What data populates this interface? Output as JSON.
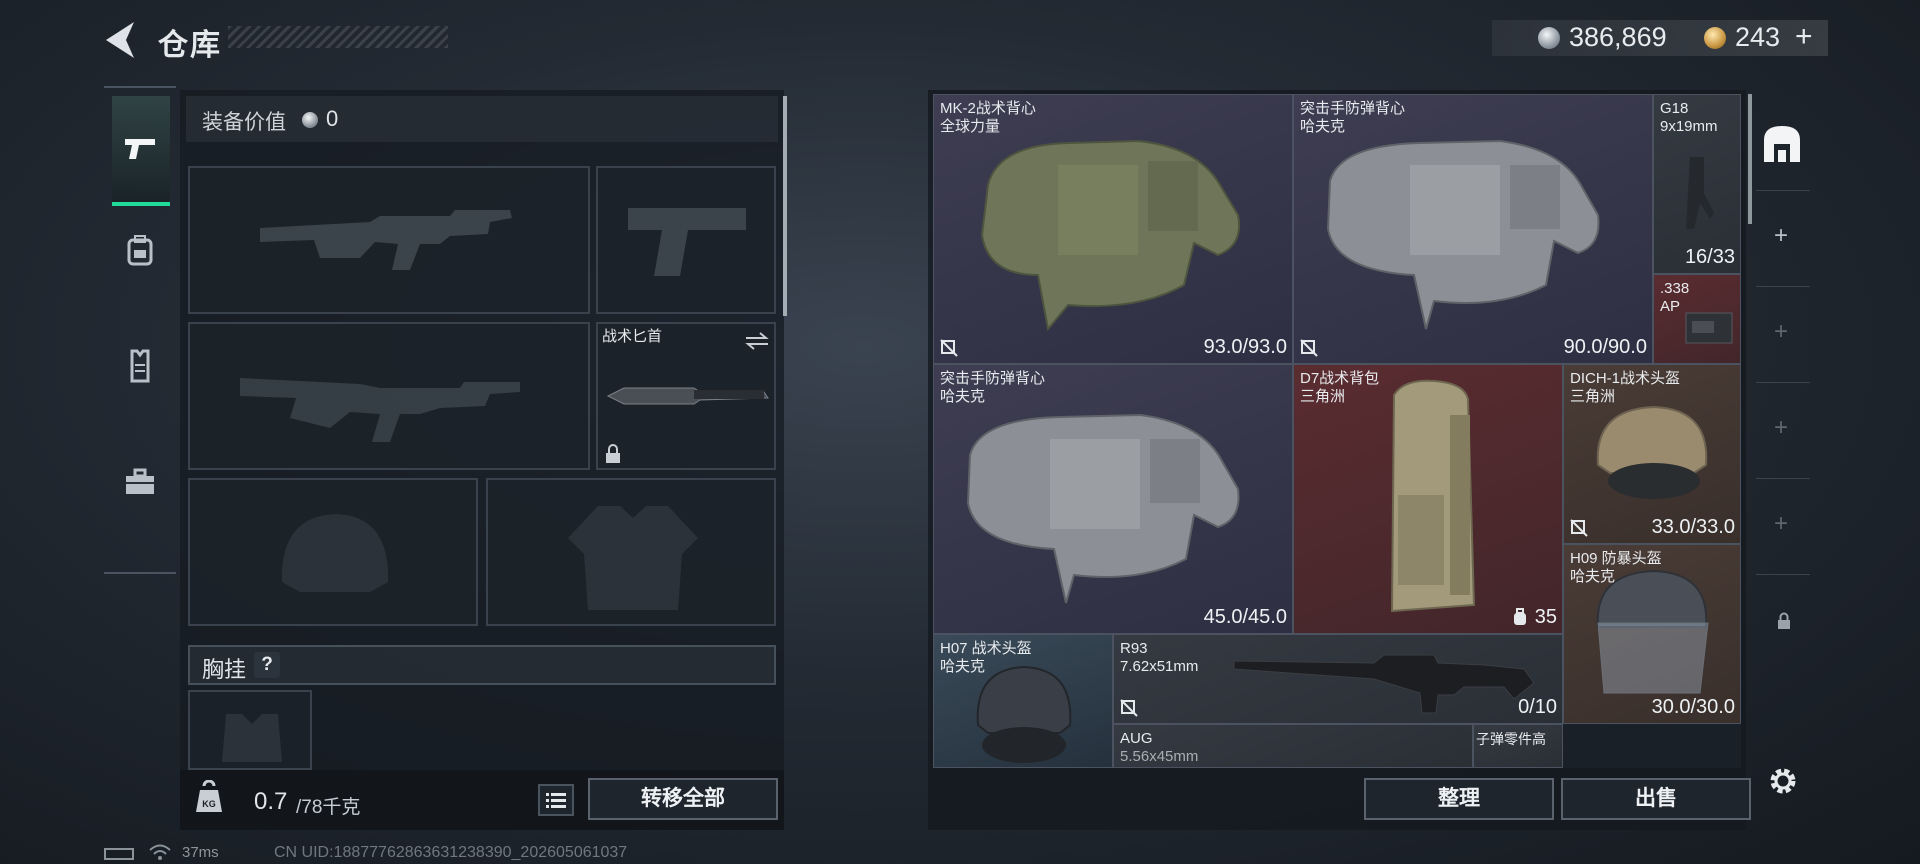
{
  "header": {
    "title": "仓库"
  },
  "currency": {
    "silver": "386,869",
    "gold": "243",
    "gold_plus": "+"
  },
  "loadout": {
    "equip_value_label": "装备价值",
    "equip_value": "0",
    "knife_label": "战术匕首",
    "chest_rig_label": "胸挂",
    "chest_rig_help": "?",
    "weight_current": "0.7",
    "weight_max": "/78千克",
    "transfer_all": "转移全部"
  },
  "stash": {
    "items": [
      {
        "name": "MK-2战术背心",
        "sub": "全球力量",
        "value": "93.0/93.0",
        "color": "purple"
      },
      {
        "name": "突击手防弹背心",
        "sub": "哈夫克",
        "value": "90.0/90.0",
        "color": "purple"
      },
      {
        "name": "G18",
        "sub": "9x19mm",
        "value": "16/33",
        "color": "dark"
      },
      {
        "name": ".338",
        "sub": "AP",
        "value": "",
        "color": "red"
      },
      {
        "name": "突击手防弹背心",
        "sub": "哈夫克",
        "value": "45.0/45.0",
        "color": "purple"
      },
      {
        "name": "D7战术背包",
        "sub": "三角洲",
        "value": "35",
        "color": "red"
      },
      {
        "name": "DICH-1战术头盔",
        "sub": "三角洲",
        "value": "33.0/33.0",
        "color": "brown"
      },
      {
        "name": "H09 防暴头盔",
        "sub": "哈夫克",
        "value": "30.0/30.0",
        "color": "brown"
      },
      {
        "name": "H07 战术头盔",
        "sub": "哈夫克",
        "value": "",
        "color": "blue"
      },
      {
        "name": "R93",
        "sub": "7.62x51mm",
        "value": "0/10",
        "color": "dark"
      },
      {
        "name": "AUG",
        "sub": "5.56x45mm",
        "value": "",
        "color": "dark"
      },
      {
        "name": "子弹零件高",
        "sub": "",
        "value": "",
        "color": "dark"
      }
    ],
    "sort_label": "整理",
    "sell_label": "出售"
  },
  "status": {
    "ping": "37ms",
    "uid": "CN UID:18877762863631238390_202605061037"
  },
  "icons": {
    "back": "back-arrow-icon",
    "tabs": [
      "pistol-icon",
      "backpack-icon",
      "vest-icon",
      "toolbox-icon"
    ],
    "rail": [
      "stash-home-icon",
      "plus-icon",
      "lock-icon",
      "gear-icon"
    ]
  },
  "colors": {
    "accent": "#1fdc9a"
  }
}
